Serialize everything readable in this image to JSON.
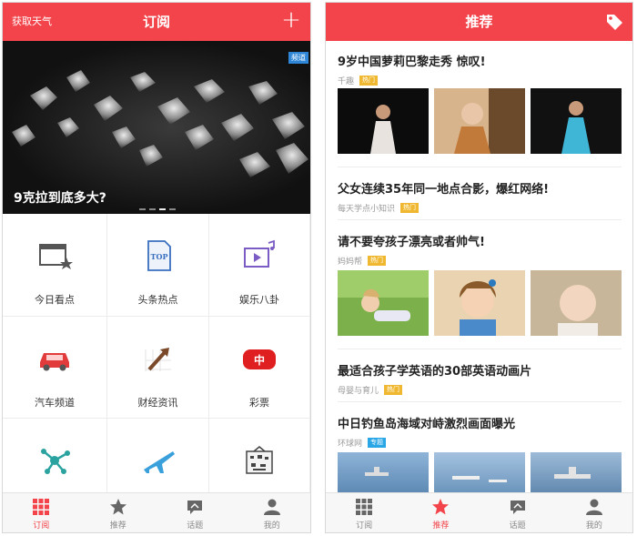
{
  "colors": {
    "accent": "#f2444a",
    "hot_pill": "#f0b830",
    "topic_pill": "#29a6e6"
  },
  "left": {
    "header": {
      "weather_link": "获取天气",
      "title": "订阅",
      "add_icon": "plus-icon",
      "add_glyph": "+"
    },
    "banner": {
      "caption": "9克拉到底多大?",
      "badge": "频道",
      "slides": 4,
      "active_slide": 3
    },
    "grid": [
      {
        "label": "今日看点",
        "icon": "calendar-star-icon"
      },
      {
        "label": "头条热点",
        "icon": "top-document-icon"
      },
      {
        "label": "娱乐八卦",
        "icon": "video-music-icon"
      },
      {
        "label": "汽车频道",
        "icon": "car-icon"
      },
      {
        "label": "财经资讯",
        "icon": "trend-arrow-icon"
      },
      {
        "label": "彩票",
        "icon": "lottery-icon"
      },
      {
        "label": "",
        "icon": "molecule-icon"
      },
      {
        "label": "",
        "icon": "airplane-icon"
      },
      {
        "label": "",
        "icon": "gift-box-icon"
      }
    ],
    "tabbar": [
      {
        "label": "订阅",
        "icon": "grid-icon",
        "active": true
      },
      {
        "label": "推荐",
        "icon": "star-icon",
        "active": false
      },
      {
        "label": "话题",
        "icon": "chat-icon",
        "active": false
      },
      {
        "label": "我的",
        "icon": "user-icon",
        "active": false
      }
    ]
  },
  "right": {
    "header": {
      "title": "推荐",
      "tag_icon": "tag-icon"
    },
    "articles": [
      {
        "title": "9岁中国萝莉巴黎走秀 惊叹!",
        "source": "千趣",
        "pill": "热门",
        "pill_type": "hot"
      },
      {
        "title": "父女连续35年同一地点合影，爆红网络!",
        "source": "每天学点小知识",
        "pill": "热门",
        "pill_type": "hot"
      },
      {
        "title": "请不要夸孩子漂亮或者帅气!",
        "source": "妈妈帮",
        "pill": "热门",
        "pill_type": "hot"
      },
      {
        "title": "最适合孩子学英语的30部英语动画片",
        "source": "母婴与育儿",
        "pill": "热门",
        "pill_type": "hot"
      },
      {
        "title": "中日钓鱼岛海域对峙激烈画面曝光",
        "source": "环球网",
        "pill": "专题",
        "pill_type": "topic"
      }
    ],
    "tabbar": [
      {
        "label": "订阅",
        "icon": "grid-icon",
        "active": false
      },
      {
        "label": "推荐",
        "icon": "star-icon",
        "active": true
      },
      {
        "label": "话题",
        "icon": "chat-icon",
        "active": false
      },
      {
        "label": "我的",
        "icon": "user-icon",
        "active": false
      }
    ]
  }
}
